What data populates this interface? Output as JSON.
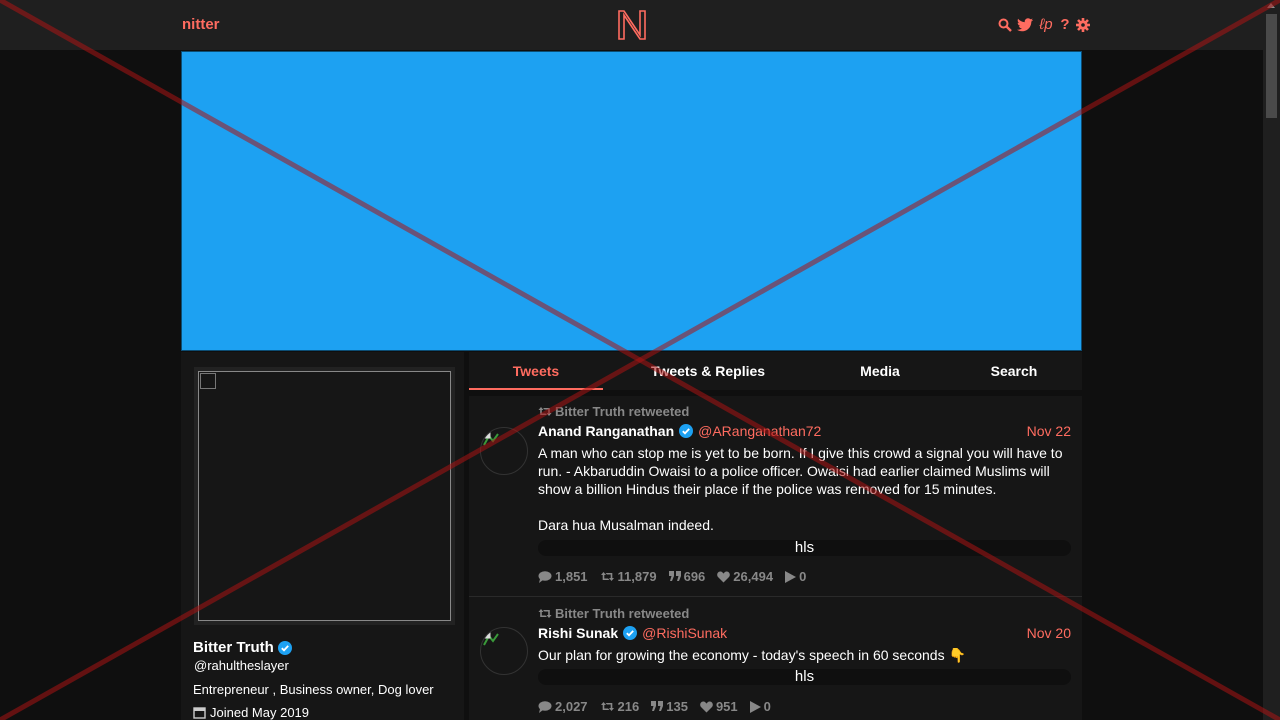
{
  "navbar": {
    "brand": "nitter",
    "icons": [
      "search-icon",
      "twitter-bird-icon",
      "lp-icon",
      "help-icon",
      "gear-icon"
    ],
    "help_glyph": "?",
    "lp_glyph": "ℓp"
  },
  "profile": {
    "name": "Bitter Truth",
    "handle": "@rahultheslayer",
    "bio": "Entrepreneur , Business owner, Dog lover",
    "joined": "Joined May 2019"
  },
  "tabs": [
    {
      "label": "Tweets",
      "active": true
    },
    {
      "label": "Tweets & Replies",
      "active": false
    },
    {
      "label": "Media",
      "active": false
    },
    {
      "label": "Search",
      "active": false
    }
  ],
  "tweets": [
    {
      "retweet_label": "Bitter Truth retweeted",
      "fullname": "Anand Ranganathan",
      "username": "@ARanganathan72",
      "date": "Nov 22",
      "text": "A man who can stop me is yet to be born. If I give this crowd a signal you will have to run. - Akbaruddin Owaisi to a police officer. Owaisi had earlier claimed Muslims will show a billion Hindus their place if the police was removed for 15 minutes.\n\nDara hua Musalman indeed.",
      "video_label": "hls",
      "replies": "1,851",
      "retweets": "11,879",
      "quotes": "696",
      "likes": "26,494",
      "views": "0"
    },
    {
      "retweet_label": "Bitter Truth retweeted",
      "fullname": "Rishi Sunak",
      "username": "@RishiSunak",
      "date": "Nov 20",
      "text": "Our plan for growing the economy - today's speech in 60 seconds 👇",
      "video_label": "hls",
      "replies": "2,027",
      "retweets": "216",
      "quotes": "135",
      "likes": "951",
      "views": "0"
    }
  ],
  "colors": {
    "accent": "#ff6c60",
    "banner": "#1da1f2",
    "background": "#0f0f0f",
    "panel": "#161616"
  }
}
